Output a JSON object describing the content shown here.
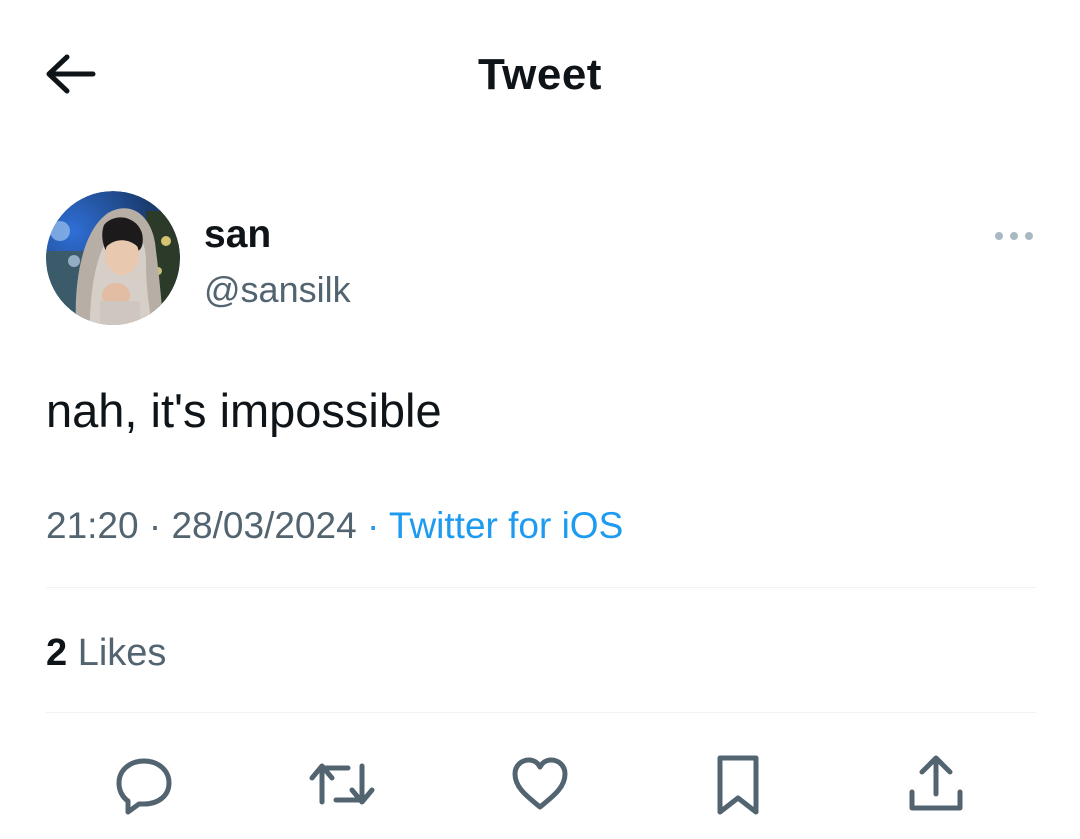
{
  "header": {
    "title": "Tweet"
  },
  "author": {
    "display_name": "san",
    "handle": "@sansilk"
  },
  "tweet": {
    "text": "nah, it's impossible",
    "time": "21:20",
    "date": "28/03/2024",
    "separator": " · ",
    "source": "Twitter for iOS"
  },
  "stats": {
    "likes_count": "2",
    "likes_label": "Likes"
  },
  "icons": {
    "back": "arrow-left-icon",
    "more": "more-horizontal-icon",
    "reply": "reply-bubble-icon",
    "retweet": "retweet-icon",
    "like": "heart-icon",
    "bookmark": "bookmark-icon",
    "share": "share-upload-icon"
  },
  "colors": {
    "text_primary": "#0f1419",
    "text_secondary": "#536471",
    "link": "#1d9bf0",
    "icon": "#536471",
    "divider": "#eff3f4"
  }
}
